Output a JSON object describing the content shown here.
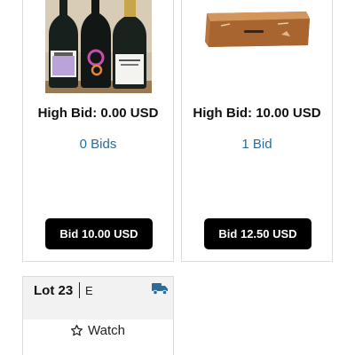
{
  "cards": [
    {
      "image": "wine-bottles-image",
      "high_bid": "High Bid: 0.00 USD",
      "bids": "0 Bids",
      "button": "Bid 10.00 USD"
    },
    {
      "image": "wooden-box-image",
      "high_bid": "High Bid: 10.00 USD",
      "bids": "1 Bid",
      "button": "Bid 12.50 USD"
    }
  ],
  "lot": {
    "title": "Lot 23",
    "code": "E",
    "shipping_icon": "truck-icon",
    "watch_icon": "star-outline-icon",
    "watch_label": "Watch"
  },
  "colors": {
    "link": "#2b6c99",
    "button_bg": "#000000",
    "button_text": "#ffffff",
    "shipping_icon": "#2b6c99",
    "card_border": "#dcdcdc",
    "header_bg": "#f2f2f2"
  }
}
